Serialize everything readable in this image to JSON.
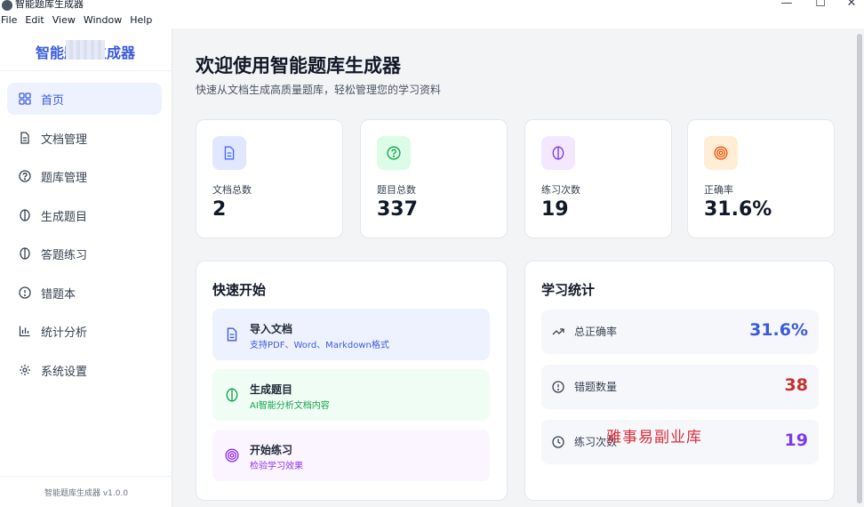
{
  "window": {
    "title": "智能题库生成器",
    "controls": {
      "minimize": "—",
      "maximize": "☐",
      "close": "✕"
    }
  },
  "menubar": {
    "items": [
      "File",
      "Edit",
      "View",
      "Window",
      "Help"
    ]
  },
  "sidebar": {
    "brand": "智能题库生成器",
    "items": [
      {
        "label": "首页",
        "icon": "grid-icon"
      },
      {
        "label": "文档管理",
        "icon": "document-icon"
      },
      {
        "label": "题库管理",
        "icon": "question-circle-icon"
      },
      {
        "label": "生成题目",
        "icon": "brain-icon"
      },
      {
        "label": "答题练习",
        "icon": "brain-icon"
      },
      {
        "label": "错题本",
        "icon": "alert-circle-icon"
      },
      {
        "label": "统计分析",
        "icon": "bar-chart-icon"
      },
      {
        "label": "系统设置",
        "icon": "gear-icon"
      }
    ],
    "version": "智能题库生成器 v1.0.0"
  },
  "main": {
    "title": "欢迎使用智能题库生成器",
    "subtitle": "快速从文档生成高质量题库，轻松管理您的学习资料",
    "stats": [
      {
        "label": "文档总数",
        "value": "2",
        "icon": "document-icon"
      },
      {
        "label": "题目总数",
        "value": "337",
        "icon": "question-circle-icon"
      },
      {
        "label": "练习次数",
        "value": "19",
        "icon": "brain-icon"
      },
      {
        "label": "正确率",
        "value": "31.6%",
        "icon": "target-icon"
      }
    ],
    "quick_start": {
      "title": "快速开始",
      "actions": [
        {
          "title": "导入文档",
          "subtitle": "支持PDF、Word、Markdown格式",
          "icon": "document-icon"
        },
        {
          "title": "生成题目",
          "subtitle": "AI智能分析文档内容",
          "icon": "brain-icon"
        },
        {
          "title": "开始练习",
          "subtitle": "检验学习效果",
          "icon": "target-icon"
        }
      ]
    },
    "learning_stats": {
      "title": "学习统计",
      "rows": [
        {
          "label": "总正确率",
          "value": "31.6%",
          "icon": "trending-up-icon"
        },
        {
          "label": "错题数量",
          "value": "38",
          "icon": "alert-circle-icon"
        },
        {
          "label": "练习次数",
          "value": "19",
          "icon": "clock-icon"
        }
      ]
    }
  },
  "watermark": "雅事易副业库",
  "colors": {
    "accent": "#3b5bdb",
    "red": "#c53030",
    "purple": "#7c3aed",
    "green": "#16a34a"
  }
}
